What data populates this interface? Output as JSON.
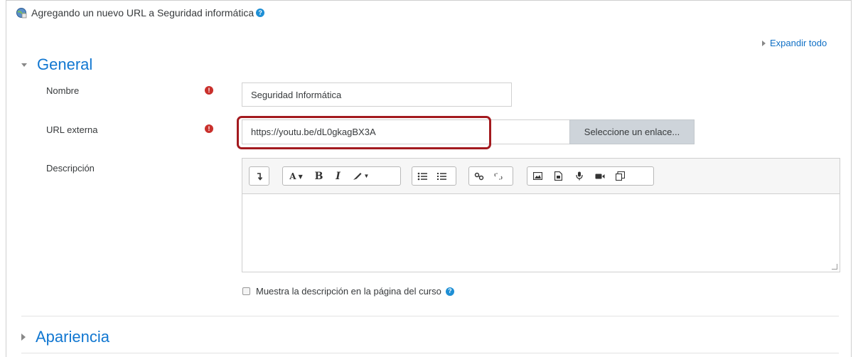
{
  "header": {
    "title": "Agregando un nuevo URL a Seguridad informática",
    "help_icon": "?"
  },
  "expand_all": "Expandir todo",
  "sections": {
    "general": "General",
    "apariencia": "Apariencia"
  },
  "fields": {
    "nombre": {
      "label": "Nombre",
      "value": "Seguridad Informática"
    },
    "url": {
      "label": "URL externa",
      "value": "https://youtu.be/dL0gkagBX3A",
      "button": "Seleccione un enlace..."
    },
    "descripcion": {
      "label": "Descripción"
    }
  },
  "required_icon": "!",
  "show_description": {
    "label": "Muestra la descripción en la página del curso",
    "checked": false
  },
  "toolbar_icons": [
    "collapse-toolbar-icon",
    "font-style-icon",
    "bold-icon",
    "italic-icon",
    "text-color-icon",
    "unordered-list-icon",
    "ordered-list-icon",
    "link-icon",
    "unlink-icon",
    "image-icon",
    "media-icon",
    "record-audio-icon",
    "record-video-icon",
    "manage-files-icon"
  ],
  "colors": {
    "accent": "#1177d1",
    "link": "#0f6fc5",
    "required": "#c9302c",
    "highlight": "#a31a1f"
  }
}
